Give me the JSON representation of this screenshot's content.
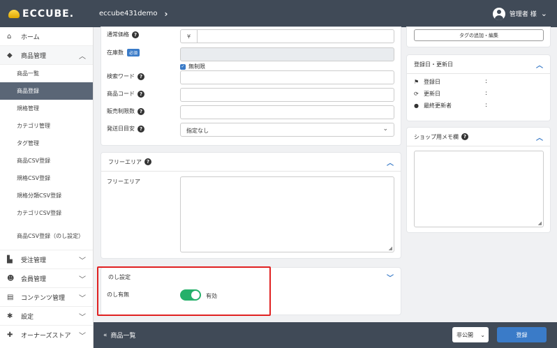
{
  "header": {
    "logo": "ECCUBE.",
    "shop": "eccube431demo",
    "user": "管理者 様"
  },
  "sidebar": {
    "home": "ホーム",
    "product_group": "商品管理",
    "product_items": [
      "商品一覧",
      "商品登録",
      "規格管理",
      "カテゴリ管理",
      "タグ管理",
      "商品CSV登録",
      "規格CSV登録",
      "規格分類CSV登録",
      "カテゴリCSV登録",
      "商品CSV登録（のし設定）"
    ],
    "order": "受注管理",
    "customer": "会員管理",
    "content": "コンテンツ管理",
    "settings": "設定",
    "store": "オーナーズストア"
  },
  "basic_form": {
    "normal_price_label": "通常価格",
    "yen": "¥",
    "stock_label": "在庫数",
    "required_badge": "必須",
    "unlimited_label": "無制限",
    "search_word_label": "検索ワード",
    "product_code_label": "商品コード",
    "sale_limit_label": "販売制限数",
    "delivery_days_label": "発送日目安",
    "delivery_days_value": "指定なし"
  },
  "free_area": {
    "title": "フリーエリア",
    "label": "フリーエリア"
  },
  "noshi": {
    "title": "のし設定",
    "label": "のし有無",
    "value": "有効"
  },
  "right": {
    "tag_button": "タグの追加・編集",
    "dates_title": "登録日・更新日",
    "created_label": "登録日",
    "updated_label": "更新日",
    "last_editor_label": "最終更新者",
    "colon": ":",
    "memo_title": "ショップ用メモ欄"
  },
  "footer": {
    "back": "商品一覧",
    "status": "非公開",
    "save": "登録"
  },
  "colors": {
    "header_bg": "#404a57",
    "accent": "#3a7bc8",
    "toggle_on": "#25b06a",
    "highlight": "#e02020"
  }
}
